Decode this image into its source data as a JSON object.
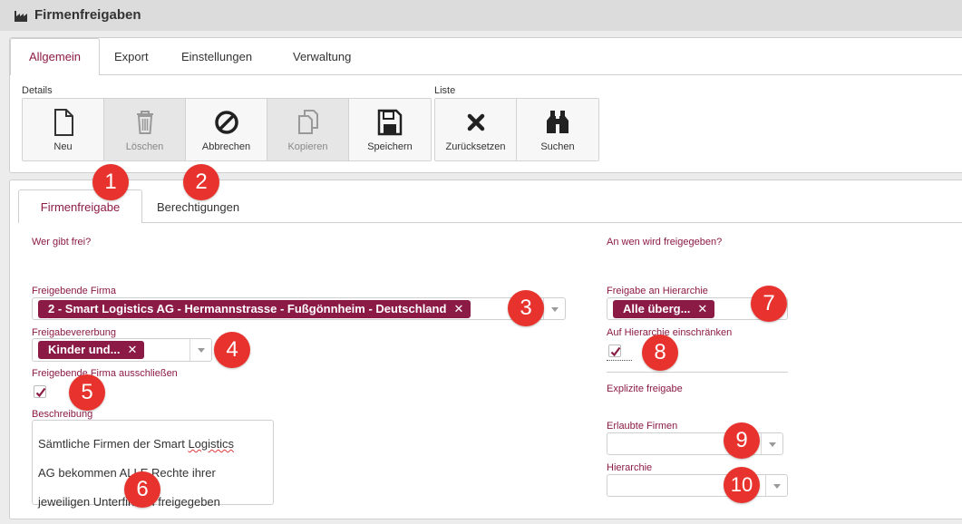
{
  "window": {
    "title": "Firmenfreigaben",
    "icon": "factory-icon"
  },
  "top_tabs": [
    {
      "label": "Allgemein",
      "active": true
    },
    {
      "label": "Export",
      "active": false
    },
    {
      "label": "Einstellungen",
      "active": false
    },
    {
      "label": "Verwaltung",
      "active": false
    }
  ],
  "toolbar": {
    "details_label": "Details",
    "liste_label": "Liste",
    "details_buttons": [
      {
        "label": "Neu",
        "icon": "new-document-icon",
        "enabled": true
      },
      {
        "label": "Löschen",
        "icon": "trash-icon",
        "enabled": false
      },
      {
        "label": "Abbrechen",
        "icon": "cancel-icon",
        "enabled": true
      },
      {
        "label": "Kopieren",
        "icon": "copy-icon",
        "enabled": false
      },
      {
        "label": "Speichern",
        "icon": "save-icon",
        "enabled": true
      }
    ],
    "liste_buttons": [
      {
        "label": "Zurücksetzen",
        "icon": "reset-x-icon",
        "enabled": true
      },
      {
        "label": "Suchen",
        "icon": "binoculars-icon",
        "enabled": true
      }
    ]
  },
  "inner_tabs": [
    {
      "label": "Firmenfreigabe",
      "active": true
    },
    {
      "label": "Berechtigungen",
      "active": false
    }
  ],
  "left": {
    "heading": "Wer gibt frei?",
    "freigebende_firma": {
      "label": "Freigebende Firma",
      "value": "2 - Smart Logistics AG - Hermannstrasse - Fußgönnheim - Deutschland"
    },
    "freigabevererbung": {
      "label": "Freigabevererbung",
      "value": "Kinder und..."
    },
    "ausschliessen": {
      "label": "Freigebende Firma ausschließen",
      "checked": true
    },
    "beschreibung": {
      "label": "Beschreibung",
      "line1_pre": "Sämtliche Firmen der Smart ",
      "line1_err": "Logistics",
      "line2": "AG bekommen ALLE Rechte ihrer",
      "line3": "jeweiligen Unterfirmen freigegeben"
    }
  },
  "right": {
    "heading": "An wen wird freigegeben?",
    "hierarchie_freigabe": {
      "label": "Freigabe an Hierarchie",
      "value": "Alle überg..."
    },
    "einschraenken": {
      "label": "Auf Hierarchie einschränken",
      "checked": true
    },
    "explizit_heading": "Explizite freigabe",
    "erlaubte_firmen": {
      "label": "Erlaubte Firmen",
      "value": ""
    },
    "hierarchie": {
      "label": "Hierarchie",
      "value": ""
    }
  },
  "badges": [
    "1",
    "2",
    "3",
    "4",
    "5",
    "6",
    "7",
    "8",
    "9",
    "10"
  ],
  "colors": {
    "accent": "#8b1a44",
    "badge": "#e8322d"
  }
}
